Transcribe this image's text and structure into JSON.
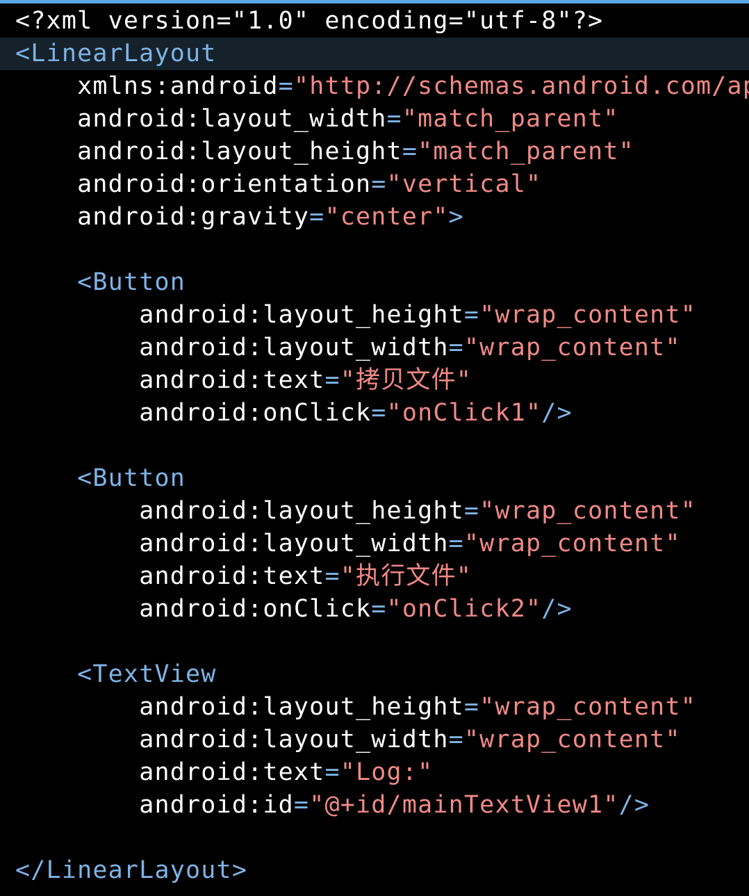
{
  "editor": {
    "colors": {
      "background": "#000000",
      "current_line": "#16222b",
      "tag": "#7fb3e6",
      "string": "#f08a86",
      "plain": "#ffffff"
    },
    "current_line_index": 1,
    "lines": [
      [
        {
          "t": "<?xml version=\"1.0\" encoding=\"utf-8\"?>",
          "k": "plain"
        }
      ],
      [
        {
          "t": "<",
          "k": "bracket"
        },
        {
          "t": "LinearLayout",
          "k": "tag"
        }
      ],
      [
        {
          "t": "    ",
          "k": "plain"
        },
        {
          "t": "xmlns:android",
          "k": "attr"
        },
        {
          "t": "=",
          "k": "eq"
        },
        {
          "t": "\"http://schemas.android.com/ap",
          "k": "str"
        }
      ],
      [
        {
          "t": "    ",
          "k": "plain"
        },
        {
          "t": "android:layout_width",
          "k": "attr"
        },
        {
          "t": "=",
          "k": "eq"
        },
        {
          "t": "\"match_parent\"",
          "k": "str"
        }
      ],
      [
        {
          "t": "    ",
          "k": "plain"
        },
        {
          "t": "android:layout_height",
          "k": "attr"
        },
        {
          "t": "=",
          "k": "eq"
        },
        {
          "t": "\"match_parent\"",
          "k": "str"
        }
      ],
      [
        {
          "t": "    ",
          "k": "plain"
        },
        {
          "t": "android:orientation",
          "k": "attr"
        },
        {
          "t": "=",
          "k": "eq"
        },
        {
          "t": "\"vertical\"",
          "k": "str"
        }
      ],
      [
        {
          "t": "    ",
          "k": "plain"
        },
        {
          "t": "android:gravity",
          "k": "attr"
        },
        {
          "t": "=",
          "k": "eq"
        },
        {
          "t": "\"center\"",
          "k": "str"
        },
        {
          "t": ">",
          "k": "bracket"
        }
      ],
      [
        {
          "t": "",
          "k": "plain"
        }
      ],
      [
        {
          "t": "    ",
          "k": "plain"
        },
        {
          "t": "<",
          "k": "bracket"
        },
        {
          "t": "Button",
          "k": "tag"
        }
      ],
      [
        {
          "t": "        ",
          "k": "plain"
        },
        {
          "t": "android:layout_height",
          "k": "attr"
        },
        {
          "t": "=",
          "k": "eq"
        },
        {
          "t": "\"wrap_content\"",
          "k": "str"
        }
      ],
      [
        {
          "t": "        ",
          "k": "plain"
        },
        {
          "t": "android:layout_width",
          "k": "attr"
        },
        {
          "t": "=",
          "k": "eq"
        },
        {
          "t": "\"wrap_content\"",
          "k": "str"
        }
      ],
      [
        {
          "t": "        ",
          "k": "plain"
        },
        {
          "t": "android:text",
          "k": "attr"
        },
        {
          "t": "=",
          "k": "eq"
        },
        {
          "t": "\"拷贝文件\"",
          "k": "str"
        }
      ],
      [
        {
          "t": "        ",
          "k": "plain"
        },
        {
          "t": "android:onClick",
          "k": "attr"
        },
        {
          "t": "=",
          "k": "eq"
        },
        {
          "t": "\"onClick1\"",
          "k": "str"
        },
        {
          "t": "/>",
          "k": "bracket"
        }
      ],
      [
        {
          "t": "",
          "k": "plain"
        }
      ],
      [
        {
          "t": "    ",
          "k": "plain"
        },
        {
          "t": "<",
          "k": "bracket"
        },
        {
          "t": "Button",
          "k": "tag"
        }
      ],
      [
        {
          "t": "        ",
          "k": "plain"
        },
        {
          "t": "android:layout_height",
          "k": "attr"
        },
        {
          "t": "=",
          "k": "eq"
        },
        {
          "t": "\"wrap_content\"",
          "k": "str"
        }
      ],
      [
        {
          "t": "        ",
          "k": "plain"
        },
        {
          "t": "android:layout_width",
          "k": "attr"
        },
        {
          "t": "=",
          "k": "eq"
        },
        {
          "t": "\"wrap_content\"",
          "k": "str"
        }
      ],
      [
        {
          "t": "        ",
          "k": "plain"
        },
        {
          "t": "android:text",
          "k": "attr"
        },
        {
          "t": "=",
          "k": "eq"
        },
        {
          "t": "\"执行文件\"",
          "k": "str"
        }
      ],
      [
        {
          "t": "        ",
          "k": "plain"
        },
        {
          "t": "android:onClick",
          "k": "attr"
        },
        {
          "t": "=",
          "k": "eq"
        },
        {
          "t": "\"onClick2\"",
          "k": "str"
        },
        {
          "t": "/>",
          "k": "bracket"
        }
      ],
      [
        {
          "t": "",
          "k": "plain"
        }
      ],
      [
        {
          "t": "    ",
          "k": "plain"
        },
        {
          "t": "<",
          "k": "bracket"
        },
        {
          "t": "TextView",
          "k": "tag"
        }
      ],
      [
        {
          "t": "        ",
          "k": "plain"
        },
        {
          "t": "android:layout_height",
          "k": "attr"
        },
        {
          "t": "=",
          "k": "eq"
        },
        {
          "t": "\"wrap_content\"",
          "k": "str"
        }
      ],
      [
        {
          "t": "        ",
          "k": "plain"
        },
        {
          "t": "android:layout_width",
          "k": "attr"
        },
        {
          "t": "=",
          "k": "eq"
        },
        {
          "t": "\"wrap_content\"",
          "k": "str"
        }
      ],
      [
        {
          "t": "        ",
          "k": "plain"
        },
        {
          "t": "android:text",
          "k": "attr"
        },
        {
          "t": "=",
          "k": "eq"
        },
        {
          "t": "\"Log:\"",
          "k": "str"
        }
      ],
      [
        {
          "t": "        ",
          "k": "plain"
        },
        {
          "t": "android:id",
          "k": "attr"
        },
        {
          "t": "=",
          "k": "eq"
        },
        {
          "t": "\"@+id/mainTextView1\"",
          "k": "str"
        },
        {
          "t": "/>",
          "k": "bracket"
        }
      ],
      [
        {
          "t": "",
          "k": "plain"
        }
      ],
      [
        {
          "t": "</",
          "k": "bracket"
        },
        {
          "t": "LinearLayout",
          "k": "tag"
        },
        {
          "t": ">",
          "k": "bracket"
        }
      ]
    ]
  }
}
